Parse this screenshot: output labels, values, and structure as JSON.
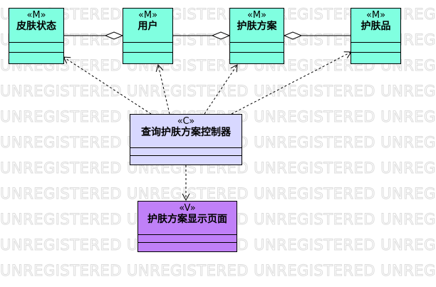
{
  "watermark": {
    "text": "UNREGISTERED UNREGISTERED UNREGISTERED UNREGISTERED"
  },
  "colors": {
    "model_fill": "#80ffe0",
    "controller_fill": "#d8d8ff",
    "view_fill": "#c080f8",
    "watermark_stroke": "#dcdcdc"
  },
  "classes": {
    "skin_state": {
      "stereotype": "«M»",
      "name": "皮肤状态"
    },
    "user": {
      "stereotype": "«M»",
      "name": "用户"
    },
    "skincare_plan": {
      "stereotype": "«M»",
      "name": "护肤方案"
    },
    "skincare_product": {
      "stereotype": "«M»",
      "name": "护肤品"
    },
    "query_controller": {
      "stereotype": "«C»",
      "name": "查询护肤方案控制器"
    },
    "plan_view": {
      "stereotype": "«V»",
      "name": "护肤方案显示页面"
    }
  },
  "relations": [
    {
      "type": "aggregation",
      "whole": "user",
      "part": "skin_state"
    },
    {
      "type": "aggregation",
      "whole": "skincare_plan",
      "part": "user"
    },
    {
      "type": "aggregation",
      "whole": "skincare_plan",
      "part": "skincare_product"
    },
    {
      "type": "dependency",
      "from": "query_controller",
      "to": "skin_state"
    },
    {
      "type": "dependency",
      "from": "query_controller",
      "to": "user"
    },
    {
      "type": "dependency",
      "from": "query_controller",
      "to": "skincare_plan"
    },
    {
      "type": "dependency",
      "from": "query_controller",
      "to": "skincare_product"
    },
    {
      "type": "dependency",
      "from": "query_controller",
      "to": "plan_view"
    }
  ]
}
